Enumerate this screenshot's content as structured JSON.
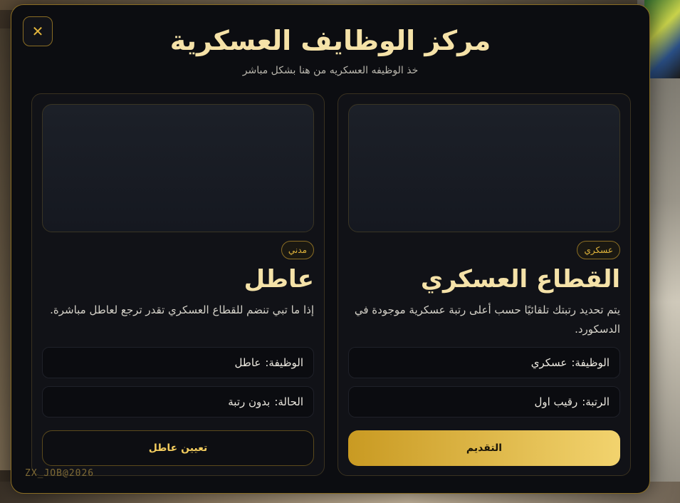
{
  "modal": {
    "title": "مركز الوظايف العسكرية",
    "subtitle": "خذ الوظيفه العسكريه من هنا بشكل مباشر",
    "close_icon": "✕",
    "footer_tag": "ZX_JOB@2026"
  },
  "cards": {
    "military": {
      "badge": "عسكري",
      "heading": "القطاع العسكري",
      "description": "يتم تحديد رتبتك تلقائيًا حسب أعلى رتبة عسكرية موجودة في الدسكورد.",
      "job_label": "الوظيفة:",
      "job_value": "عسكري",
      "rank_label": "الرتبة:",
      "rank_value": "رقيب اول",
      "action_label": "التقديم"
    },
    "civilian": {
      "badge": "مدني",
      "heading": "عاطل",
      "description": "إذا ما تبي تنضم للقطاع العسكري تقدر ترجع لعاطل مباشرة.",
      "job_label": "الوظيفة:",
      "job_value": "عاطل",
      "status_label": "الحالة:",
      "status_value": "بدون رتبة",
      "action_label": "تعيين عاطل"
    }
  },
  "colors": {
    "accent": "#e2b53c",
    "title": "#f5e2a8",
    "panel": "#0c0d11"
  }
}
